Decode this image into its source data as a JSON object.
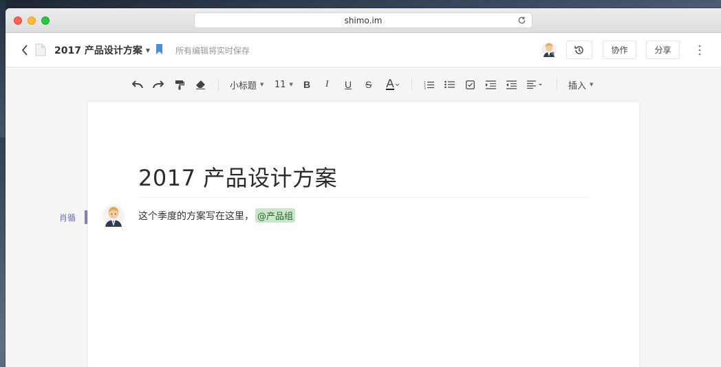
{
  "browser": {
    "url": "shimo.im"
  },
  "header": {
    "doc_title": "2017 产品设计方案",
    "save_status": "所有编辑将实时保存",
    "collab_label": "协作",
    "share_label": "分享"
  },
  "toolbar": {
    "style_label": "小标题",
    "font_size": "11",
    "insert_label": "插入"
  },
  "document": {
    "title": "2017 产品设计方案",
    "paragraph": "这个季度的方案写在这里，",
    "mention": "@产品组",
    "author": "肖循"
  },
  "colors": {
    "accent_blue": "#4a90e2",
    "author_purple": "#8779c2",
    "mention_bg": "#c8e8c8"
  }
}
